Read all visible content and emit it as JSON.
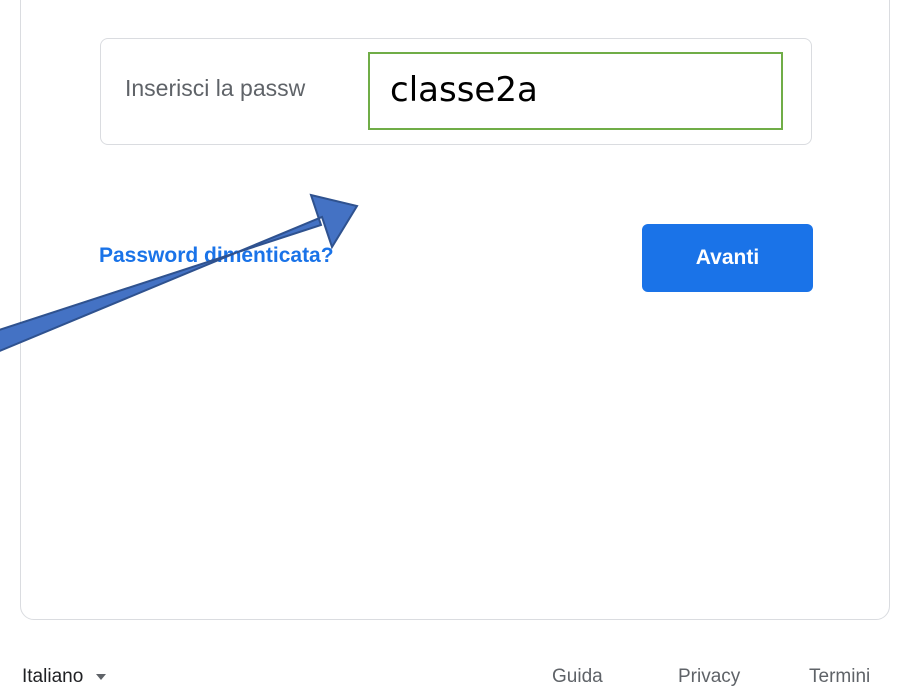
{
  "password_field": {
    "placeholder_visible": "Inserisci la passw"
  },
  "annotation": {
    "overlay_text": "classe2a",
    "overlay_border_color": "#70ad47",
    "arrow_fill_color": "#4472c4",
    "arrow_outline_color": "#2f528f"
  },
  "actions": {
    "forgot_password_link": "Password dimenticata?",
    "next_button": "Avanti"
  },
  "footer": {
    "language": "Italiano",
    "links": {
      "help": "Guida",
      "privacy": "Privacy",
      "terms": "Termini"
    }
  },
  "colors": {
    "accent": "#1a73e8",
    "border": "#dadce0"
  }
}
